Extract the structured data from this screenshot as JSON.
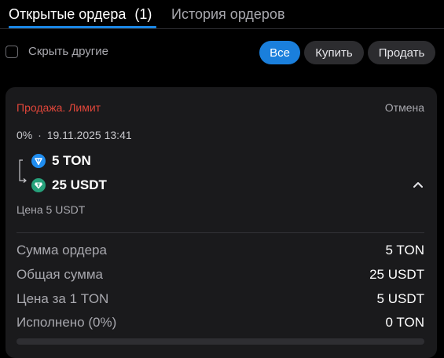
{
  "tabs": {
    "open_orders_label": "Открытые ордера",
    "open_orders_count": "(1)",
    "history_label": "История ордеров"
  },
  "filters": {
    "hide_others_label": "Скрыть другие",
    "hide_others_checked": false,
    "all_label": "Все",
    "buy_label": "Купить",
    "sell_label": "Продать",
    "selected": "all"
  },
  "order": {
    "type_label": "Продажа. Лимит",
    "cancel_label": "Отмена",
    "fill_percent_label": "0%",
    "separator": "·",
    "datetime": "19.11.2025 13:41",
    "from_amount": "5 TON",
    "to_amount": "25 USDT",
    "price_line": "Цена 5 USDT",
    "details": [
      {
        "label": "Сумма ордера",
        "value": "5 TON"
      },
      {
        "label": "Общая сумма",
        "value": "25 USDT"
      },
      {
        "label": "Цена за 1 TON",
        "value": "5 USDT"
      },
      {
        "label": "Исполнено (0%)",
        "value": "0 TON"
      }
    ],
    "progress_fraction": 0
  },
  "colors": {
    "accent": "#1a7fdc",
    "sell_red": "#e0463a",
    "ton_blue": "#1f8df0",
    "usdt_teal": "#26a17b"
  },
  "icons": {
    "from_coin": "ton-coin-icon",
    "to_coin": "usdt-coin-icon",
    "collapse": "chevron-up-icon",
    "flow": "arrow-bracket-icon"
  }
}
